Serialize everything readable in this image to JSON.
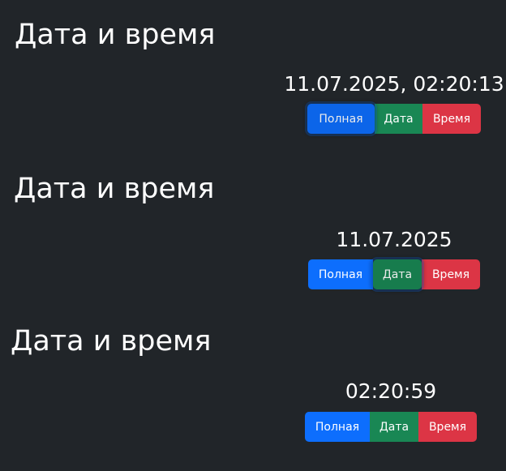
{
  "widgets": [
    {
      "title": "Дата и время",
      "display_value": "11.07.2025, 02:20:13",
      "active_mode": "Полная",
      "buttons": {
        "full": "Полная",
        "date": "Дата",
        "time": "Время"
      }
    },
    {
      "title": "Дата и время",
      "display_value": "11.07.2025",
      "active_mode": "Дата",
      "buttons": {
        "full": "Полная",
        "date": "Дата",
        "time": "Время"
      }
    },
    {
      "title": "Дата и время",
      "display_value": "02:20:59",
      "active_mode": "Время",
      "buttons": {
        "full": "Полная",
        "date": "Дата",
        "time": "Время"
      }
    }
  ],
  "colors": {
    "background": "#212529",
    "full_button": "#0d6efd",
    "date_button": "#198754",
    "time_button": "#dc3545",
    "text": "#ffffff"
  }
}
